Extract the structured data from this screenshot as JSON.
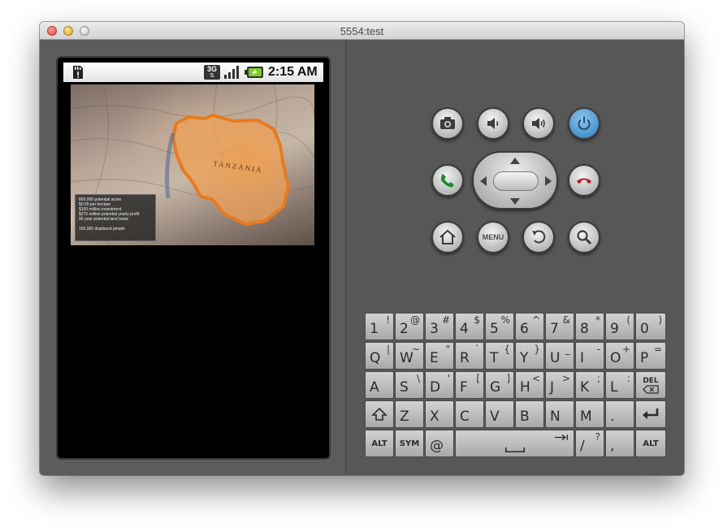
{
  "window": {
    "title": "5554:test"
  },
  "statusbar": {
    "time": "2:15 AM",
    "network_label": "3G",
    "icons": [
      "sd-card-icon",
      "network-3g-icon",
      "signal-strength-icon",
      "battery-charging-icon"
    ]
  },
  "map": {
    "country_label": "TANZANIA",
    "caption": [
      "800,000 potential acres",
      "$0.55 per hectare",
      "$100 million investment",
      "$275 million potential yearly profit",
      "99 year potential land lease",
      "160,000 displaced people"
    ]
  },
  "controls": {
    "menu_label": "MENU",
    "icons": [
      "camera-icon",
      "volume-down-icon",
      "volume-up-icon",
      "power-icon",
      "call-icon",
      "end-call-icon",
      "home-icon",
      "back-icon",
      "search-icon"
    ]
  },
  "keyboard": {
    "row1": [
      {
        "main": "1",
        "alt": "!"
      },
      {
        "main": "2",
        "alt": "@"
      },
      {
        "main": "3",
        "alt": "#"
      },
      {
        "main": "4",
        "alt": "$"
      },
      {
        "main": "5",
        "alt": "%"
      },
      {
        "main": "6",
        "alt": "^"
      },
      {
        "main": "7",
        "alt": "&"
      },
      {
        "main": "8",
        "alt": "*"
      },
      {
        "main": "9",
        "alt": "("
      },
      {
        "main": "0",
        "alt": ")"
      }
    ],
    "row2": [
      {
        "main": "Q",
        "alt": "|"
      },
      {
        "main": "W",
        "alt": "~"
      },
      {
        "main": "E",
        "alt": "\""
      },
      {
        "main": "R",
        "alt": "`"
      },
      {
        "main": "T",
        "alt": "{"
      },
      {
        "main": "Y",
        "alt": "}"
      },
      {
        "main": "U",
        "alt": "_"
      },
      {
        "main": "I",
        "alt": "-"
      },
      {
        "main": "O",
        "alt": "+"
      },
      {
        "main": "P",
        "alt": "="
      }
    ],
    "row3": [
      {
        "main": "A",
        "alt": ""
      },
      {
        "main": "S",
        "alt": "\\"
      },
      {
        "main": "D",
        "alt": "'"
      },
      {
        "main": "F",
        "alt": "["
      },
      {
        "main": "G",
        "alt": "]"
      },
      {
        "main": "H",
        "alt": "<"
      },
      {
        "main": "J",
        "alt": ">"
      },
      {
        "main": "K",
        "alt": ";"
      },
      {
        "main": "L",
        "alt": ":"
      }
    ],
    "del_label": "DEL",
    "row4": [
      "Z",
      "X",
      "C",
      "V",
      "B",
      "N",
      "M",
      "."
    ],
    "alt_label": "ALT",
    "sym_label": "SYM",
    "at_label": "@",
    "slash_main": "/",
    "slash_alt": "?",
    "comma_label": ","
  }
}
